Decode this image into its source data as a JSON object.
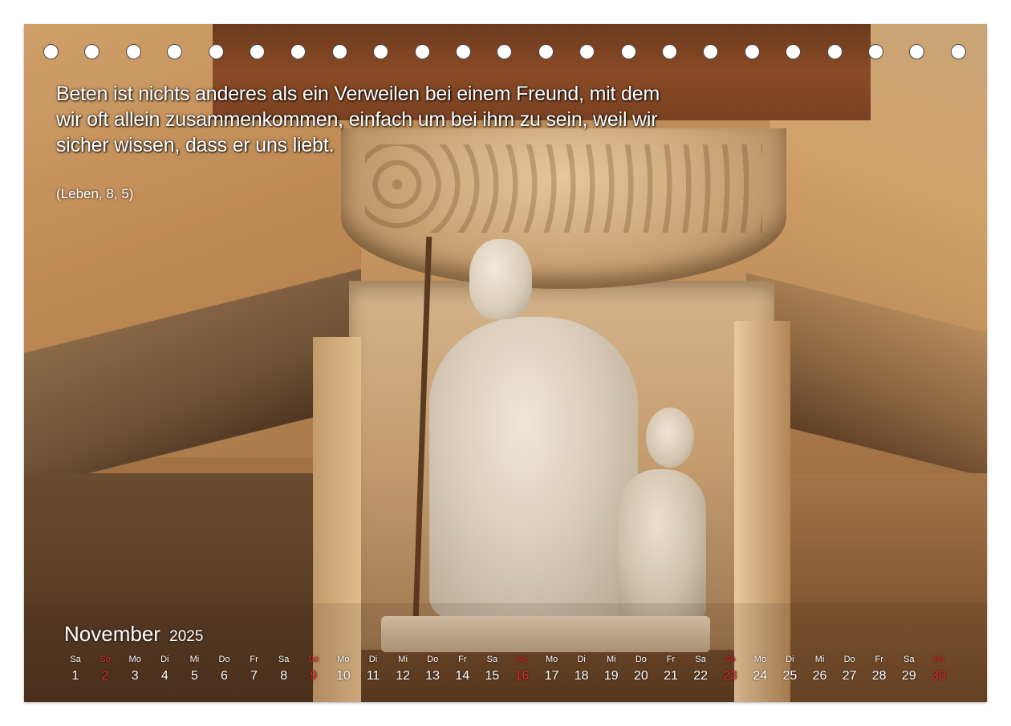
{
  "quote": {
    "line1": "Beten ist nichts anderes als ein Verweilen bei einem Freund, mit dem",
    "line2": "wir oft allein zusammenkommen, einfach um bei ihm zu sein, weil wir",
    "line3": "sicher wissen, dass er uns liebt.",
    "source": "(Leben, 8, 5)"
  },
  "calendar": {
    "month": "November",
    "year": "2025",
    "sunday_color": "#e8282b",
    "days": [
      {
        "wd": "Sa",
        "d": "1",
        "sun": false
      },
      {
        "wd": "So",
        "d": "2",
        "sun": true
      },
      {
        "wd": "Mo",
        "d": "3",
        "sun": false
      },
      {
        "wd": "Di",
        "d": "4",
        "sun": false
      },
      {
        "wd": "Mi",
        "d": "5",
        "sun": false
      },
      {
        "wd": "Do",
        "d": "6",
        "sun": false
      },
      {
        "wd": "Fr",
        "d": "7",
        "sun": false
      },
      {
        "wd": "Sa",
        "d": "8",
        "sun": false
      },
      {
        "wd": "So",
        "d": "9",
        "sun": true
      },
      {
        "wd": "Mo",
        "d": "10",
        "sun": false
      },
      {
        "wd": "Di",
        "d": "11",
        "sun": false
      },
      {
        "wd": "Mi",
        "d": "12",
        "sun": false
      },
      {
        "wd": "Do",
        "d": "13",
        "sun": false
      },
      {
        "wd": "Fr",
        "d": "14",
        "sun": false
      },
      {
        "wd": "Sa",
        "d": "15",
        "sun": false
      },
      {
        "wd": "So",
        "d": "16",
        "sun": true
      },
      {
        "wd": "Mo",
        "d": "17",
        "sun": false
      },
      {
        "wd": "Di",
        "d": "18",
        "sun": false
      },
      {
        "wd": "Mi",
        "d": "19",
        "sun": false
      },
      {
        "wd": "Do",
        "d": "20",
        "sun": false
      },
      {
        "wd": "Fr",
        "d": "21",
        "sun": false
      },
      {
        "wd": "Sa",
        "d": "22",
        "sun": false
      },
      {
        "wd": "So",
        "d": "23",
        "sun": true
      },
      {
        "wd": "Mo",
        "d": "24",
        "sun": false
      },
      {
        "wd": "Di",
        "d": "25",
        "sun": false
      },
      {
        "wd": "Mi",
        "d": "26",
        "sun": false
      },
      {
        "wd": "Do",
        "d": "27",
        "sun": false
      },
      {
        "wd": "Fr",
        "d": "28",
        "sun": false
      },
      {
        "wd": "Sa",
        "d": "29",
        "sun": false
      },
      {
        "wd": "So",
        "d": "30",
        "sun": true
      }
    ]
  },
  "binding": {
    "hole_count": 23
  }
}
